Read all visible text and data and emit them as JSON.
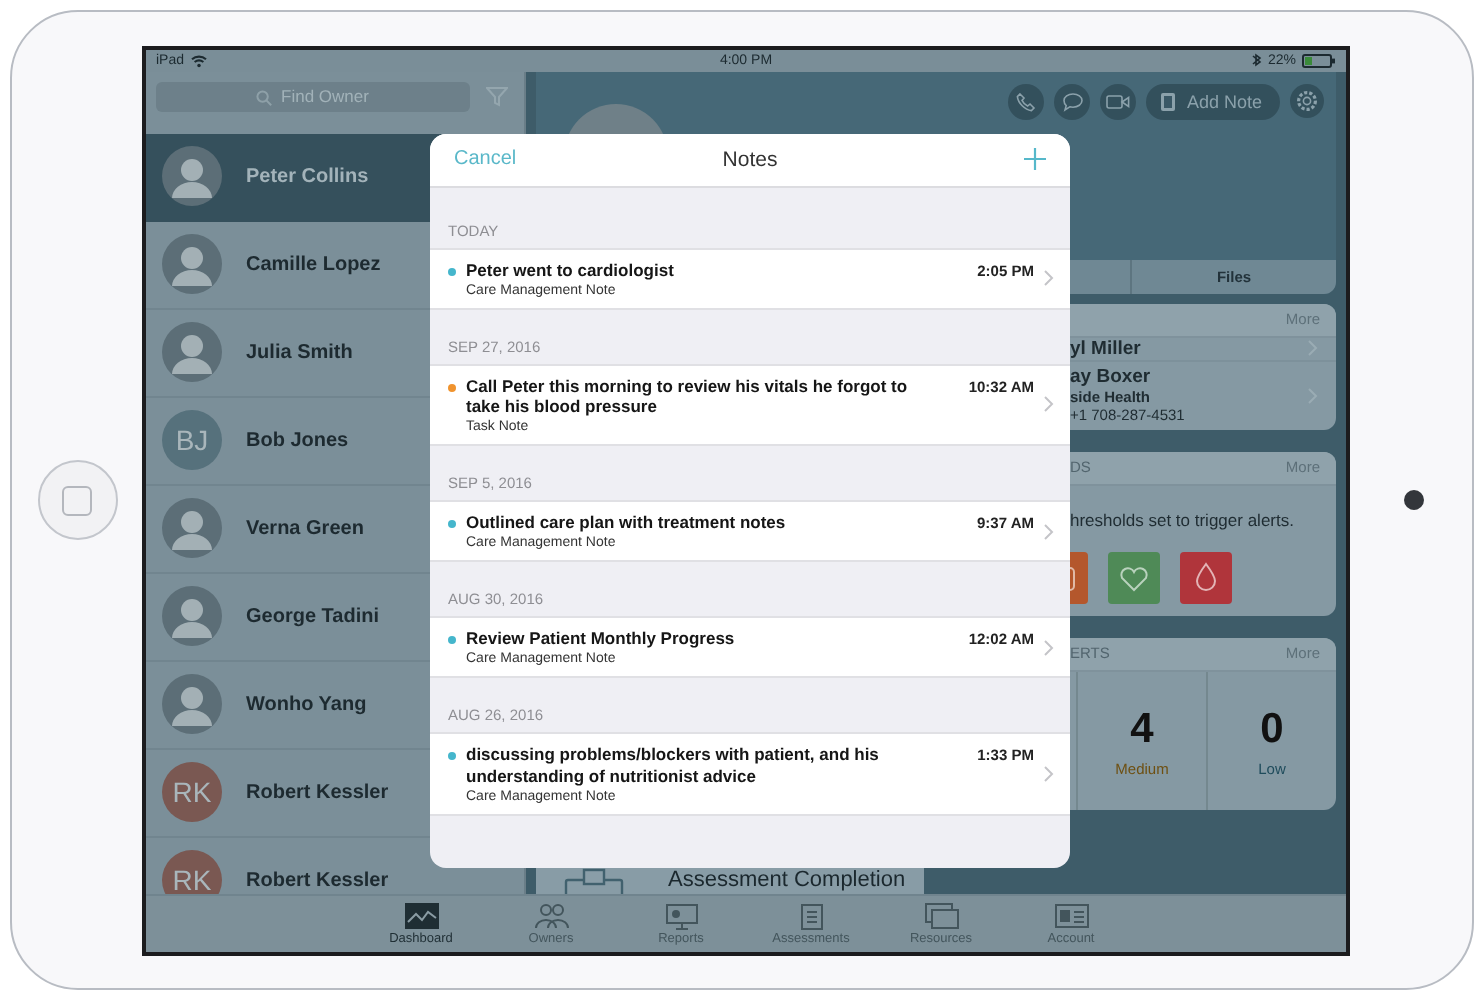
{
  "status_bar": {
    "device": "iPad",
    "time": "4:00 PM",
    "battery": "22%"
  },
  "sidebar": {
    "search": {
      "placeholder": "Find Owner"
    },
    "owners": [
      {
        "name": "Peter Collins",
        "selected": true,
        "kind": "photo"
      },
      {
        "name": "Camille Lopez",
        "selected": false,
        "kind": "photo"
      },
      {
        "name": "Julia Smith",
        "selected": false,
        "kind": "photo"
      },
      {
        "name": "Bob Jones",
        "selected": false,
        "kind": "initials",
        "initials": "BJ",
        "color": "#56717c"
      },
      {
        "name": "Verna Green",
        "selected": false,
        "kind": "photo"
      },
      {
        "name": "George Tadini",
        "selected": false,
        "kind": "photo"
      },
      {
        "name": "Wonho Yang",
        "selected": false,
        "kind": "photo"
      },
      {
        "name": "Robert Kessler",
        "selected": false,
        "kind": "initials",
        "initials": "RK",
        "color": "#7a5852"
      },
      {
        "name": "Robert Kessler",
        "selected": false,
        "kind": "initials",
        "initials": "RK",
        "color": "#7a5852"
      }
    ]
  },
  "profile": {
    "actions": [
      {
        "kind": "phone"
      },
      {
        "kind": "chat"
      },
      {
        "kind": "video"
      }
    ],
    "add_note": "Add Note",
    "tab": "Files"
  },
  "contacts_card": {
    "more": "More",
    "contacts": [
      {
        "lines": [
          "yl Miller"
        ]
      },
      {
        "lines": [
          "ay Boxer",
          "side Health",
          "+1 708-287-4531"
        ]
      }
    ]
  },
  "thresholds_card": {
    "header": "DS",
    "more": "More",
    "text": "hresholds set to trigger alerts.",
    "icons": [
      {
        "kind": "scale",
        "color": "#b4572c"
      },
      {
        "kind": "heart",
        "color": "#4f8a57"
      },
      {
        "kind": "drop",
        "color": "#b0353b"
      }
    ]
  },
  "alerts_card": {
    "header": "ERTS",
    "more": "More",
    "counts": [
      {
        "value": "4",
        "label": "Medium",
        "color": "#6e5012"
      },
      {
        "value": "0",
        "label": "Low",
        "color": "#1f4c5c"
      }
    ]
  },
  "assessment_card": {
    "title": "Assessment Completion"
  },
  "notes_modal": {
    "cancel": "Cancel",
    "title": "Notes",
    "sections": [
      {
        "date": "TODAY",
        "notes": [
          {
            "title": "Peter went to cardiologist",
            "type": "Care Management Note",
            "time": "2:05 PM",
            "color": "#45b6cc"
          }
        ]
      },
      {
        "date": "SEP 27, 2016",
        "notes": [
          {
            "title": "Call Peter this morning to review his vitals he forgot to take his blood pressure",
            "type": "Task Note",
            "time": "10:32 AM",
            "color": "#f0932e"
          }
        ]
      },
      {
        "date": "SEP 5, 2016",
        "notes": [
          {
            "title": "Outlined care plan with treatment notes",
            "type": "Care Management Note",
            "time": "9:37 AM",
            "color": "#45b6cc"
          }
        ]
      },
      {
        "date": "AUG 30, 2016",
        "notes": [
          {
            "title": "Review Patient Monthly Progress",
            "type": "Care Management Note",
            "time": "12:02 AM",
            "color": "#45b6cc"
          }
        ]
      },
      {
        "date": "AUG 26, 2016",
        "notes": [
          {
            "title": "discussing problems/blockers with patient, and his understanding of nutritionist advice",
            "type": "Care Management Note",
            "time": "1:33 PM",
            "color": "#45b6cc"
          }
        ]
      }
    ]
  },
  "tab_bar": [
    {
      "label": "Dashboard",
      "kind": "chart",
      "selected": true
    },
    {
      "label": "Owners",
      "kind": "people",
      "selected": false
    },
    {
      "label": "Reports",
      "kind": "board",
      "selected": false
    },
    {
      "label": "Assessments",
      "kind": "clipboard",
      "selected": false
    },
    {
      "label": "Resources",
      "kind": "stack",
      "selected": false
    },
    {
      "label": "Account",
      "kind": "card",
      "selected": false
    }
  ]
}
